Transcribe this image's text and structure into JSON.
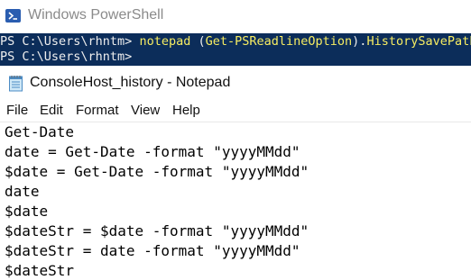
{
  "powershell": {
    "window_title": "Windows PowerShell",
    "lines": [
      {
        "prompt": "PS C:\\Users\\rhntm> ",
        "command": "notepad",
        "arg_open": " (",
        "arg_cmd": "Get-PSReadlineOption",
        "arg_close": ").",
        "property": "HistorySavePath"
      },
      {
        "prompt": "PS C:\\Users\\rhntm>"
      }
    ],
    "colors": {
      "background": "#0c2d5a",
      "command": "#f7ed62",
      "text": "#eeeeee"
    }
  },
  "notepad": {
    "window_title": "ConsoleHost_history - Notepad",
    "menu": [
      "File",
      "Edit",
      "Format",
      "View",
      "Help"
    ],
    "content_lines": [
      "Get-Date",
      "date = Get-Date -format \"yyyyMMdd\"",
      "$date = Get-Date -format \"yyyyMMdd\"",
      "date",
      "$date",
      "$dateStr = $date -format \"yyyyMMdd\"",
      "$dateStr = date -format \"yyyyMMdd\"",
      "$dateStr"
    ]
  }
}
